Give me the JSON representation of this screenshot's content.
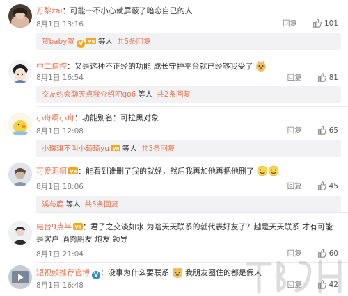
{
  "actions": {
    "reply_label": "回复"
  },
  "comments": [
    {
      "user": "万黎zai",
      "sep": "：",
      "text": "可能一不小心就屏蔽了暗恋自己的人",
      "date": "8月1日 13:16",
      "likes": "101",
      "replies_bar": {
        "user": "贺baby贺",
        "suffix": "等人",
        "total": "共5条回复"
      }
    },
    {
      "user": "中二病控",
      "sep": "：",
      "text": "又是这种不正经的功能 成长守护平台就已经够我受了",
      "date": "8月1日 16:54",
      "likes": "81",
      "replies_bar": {
        "user": "交友约会聊天点我介绍吧qo6",
        "suffix": "等人",
        "total": "共2条回复"
      }
    },
    {
      "user": "小舟啊小舟",
      "sep": "：",
      "text": "功能别名：可拉黑对象",
      "date": "8月1日 12:08",
      "likes": "65",
      "replies_bar": {
        "user": "小琪琪不叫小琦琦yu",
        "suffix": "等人",
        "total": "共3条回复"
      }
    },
    {
      "user": "可爱泥啊",
      "sep": "：",
      "text": "能看到谁删了我的就好，然后我再加他再把他删了",
      "date": "8月1日 18:06",
      "likes": "45",
      "replies_bar": {
        "user": "溪与鹿",
        "suffix": "等人",
        "total": "共5条回复"
      }
    },
    {
      "user": "电台9点半",
      "sep": "：",
      "text": "君子之交淡如水   为啥天天联系的就代表好友了？越是天天联系  才有可能是客户  酒肉朋友  炮友  领导",
      "date": "8月1日 21:04",
      "likes": "60"
    },
    {
      "user": "短视频推荐官博",
      "sep": "：",
      "text": "没事为什么要联系",
      "text2": "我朋友圈住的都是假人",
      "date": "8月1日 16:48",
      "likes": "42"
    }
  ],
  "colors": {
    "name": "#eb7350",
    "bar": "#f2f2f5",
    "meta": "#808080"
  },
  "icons": [
    "verified-v-icon",
    "vip-icon",
    "thumb-up-icon",
    "doge-emoji",
    "smile-emoji"
  ]
}
